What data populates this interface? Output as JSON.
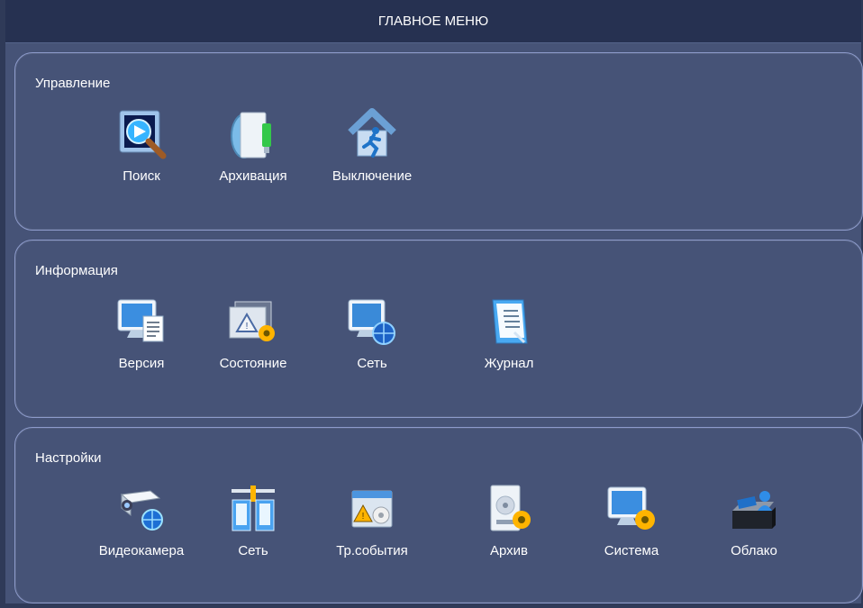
{
  "window": {
    "title": "ГЛАВНОЕ МЕНЮ"
  },
  "sections": [
    {
      "title": "Управление",
      "items": [
        {
          "label": "Поиск",
          "icon": "search-video-icon"
        },
        {
          "label": "Архивация",
          "icon": "usb-backup-icon"
        },
        {
          "label": "Выключение",
          "icon": "shutdown-exit-icon"
        }
      ]
    },
    {
      "title": "Информация",
      "items": [
        {
          "label": "Версия",
          "icon": "version-monitor-icon"
        },
        {
          "label": "Состояние",
          "icon": "status-warning-gear-icon"
        },
        {
          "label": "Сеть",
          "icon": "network-globe-monitor-icon"
        },
        {
          "label": "Журнал",
          "icon": "log-journal-icon"
        }
      ]
    },
    {
      "title": "Настройки",
      "items": [
        {
          "label": "Видеокамера",
          "icon": "camera-globe-icon"
        },
        {
          "label": "Сеть",
          "icon": "network-switch-icon"
        },
        {
          "label": "Тр.события",
          "icon": "event-alarm-gear-icon"
        },
        {
          "label": "Архив",
          "icon": "storage-hdd-gear-icon"
        },
        {
          "label": "Система",
          "icon": "system-monitor-gear-icon"
        },
        {
          "label": "Облако",
          "icon": "cloud-user-icon"
        }
      ]
    }
  ],
  "colors": {
    "panel": "#465377",
    "title_bar": "#263151",
    "border": "#8d9bcb",
    "text": "#ffffff"
  }
}
